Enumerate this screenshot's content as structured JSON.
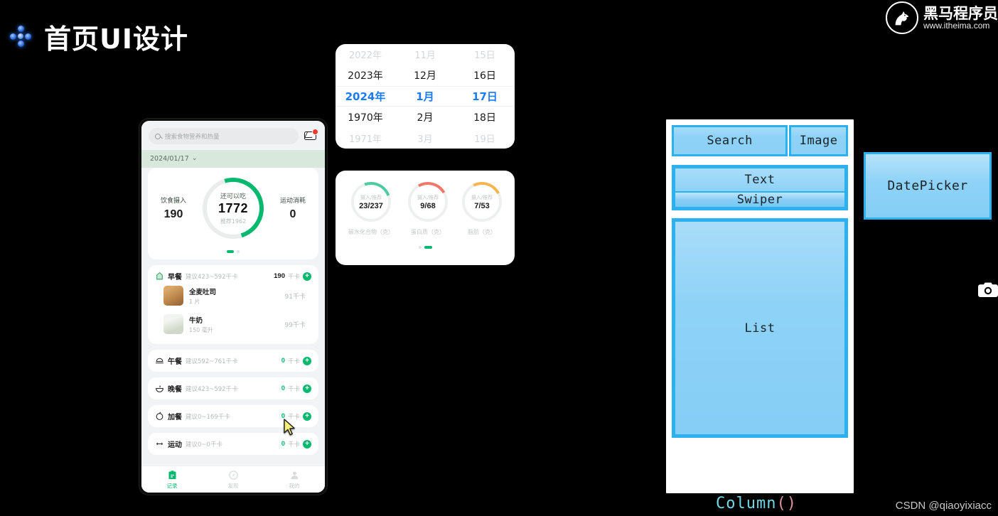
{
  "slide": {
    "title": "首页UI设计",
    "bullet_icon": "diamond-cluster-icon"
  },
  "brand": {
    "mark_icon": "horse-head-logo",
    "name": "黑马程序员",
    "url": "www.itheima.com"
  },
  "phone": {
    "search": {
      "icon": "search-icon",
      "placeholder": "搜索食物营养和热量"
    },
    "mail_icon": "envelope-icon",
    "mail_badge": "",
    "date_bar": {
      "value": "2024/01/17",
      "chevron": "⌄"
    },
    "summary": {
      "intake_label": "饮食摄入",
      "intake_value": "190",
      "ring_top": "还可以吃",
      "ring_value": "1772",
      "ring_sub": "推荐1962",
      "burn_label": "运动消耗",
      "burn_value": "0"
    },
    "meals": [
      {
        "icon": "breakfast-icon",
        "name": "早餐",
        "suggest": "建议423~592千卡",
        "kcal": "190",
        "unit": "千卡",
        "add": "+",
        "foods": [
          {
            "name": "全麦吐司",
            "qty": "1 片",
            "kcal": "91千卡",
            "thumb": "toast"
          },
          {
            "name": "牛奶",
            "qty": "150 毫升",
            "kcal": "99千卡",
            "thumb": "milk"
          }
        ]
      },
      {
        "icon": "lunch-icon",
        "name": "午餐",
        "suggest": "建议592~761千卡",
        "kcal": "0",
        "unit": "千卡",
        "add": "+",
        "foods": []
      },
      {
        "icon": "dinner-icon",
        "name": "晚餐",
        "suggest": "建议423~592千卡",
        "kcal": "0",
        "unit": "千卡",
        "add": "+",
        "foods": []
      },
      {
        "icon": "snack-icon",
        "name": "加餐",
        "suggest": "建议0~169千卡",
        "kcal": "0",
        "unit": "千卡",
        "add": "+",
        "foods": []
      },
      {
        "icon": "exercise-icon",
        "name": "运动",
        "suggest": "建议0~0千卡",
        "kcal": "0",
        "unit": "千卡",
        "add": "+",
        "foods": []
      }
    ],
    "tabs": [
      {
        "icon": "record-icon",
        "label": "记录",
        "active": true
      },
      {
        "icon": "discover-icon",
        "label": "发现",
        "active": false
      },
      {
        "icon": "profile-icon",
        "label": "我的",
        "active": false
      }
    ]
  },
  "date_picker_card": {
    "columns": [
      "year",
      "month",
      "day"
    ],
    "rows": [
      {
        "year": "2022年",
        "month": "11月",
        "day": "15日",
        "state": "faded-top"
      },
      {
        "year": "2023年",
        "month": "12月",
        "day": "16日",
        "state": "normal"
      },
      {
        "year": "2024年",
        "month": "1月",
        "day": "17日",
        "state": "selected"
      },
      {
        "year": "1970年",
        "month": "2月",
        "day": "18日",
        "state": "normal"
      },
      {
        "year": "1971年",
        "month": "3月",
        "day": "19日",
        "state": "faded-bot"
      }
    ],
    "selected_color": "#1a7bf2"
  },
  "nutrient_card": {
    "items": [
      {
        "ring_top": "摄入/推荐",
        "value": "23/237",
        "label": "碳水化合物（克）",
        "color": "#4ecba0"
      },
      {
        "ring_top": "摄入/推荐",
        "value": "9/68",
        "label": "蛋白质（克）",
        "color": "#f2796a"
      },
      {
        "ring_top": "摄入/推荐",
        "value": "7/53",
        "label": "脂肪（克）",
        "color": "#f5b651"
      }
    ],
    "pagination": {
      "total": 2,
      "active": 2
    }
  },
  "structure": {
    "search": "Search",
    "image": "Image",
    "text": "Text",
    "swiper": "Swiper",
    "list": "List",
    "column_label_name": "Column",
    "column_label_parens": "()",
    "accent": "#2bb0f0",
    "fill": "#8ed2f7"
  },
  "datepicker_box": {
    "label": "DatePicker"
  },
  "overlay": {
    "camera_icon": "camera-icon",
    "watermark": "CSDN @qiaoyixiacc"
  }
}
